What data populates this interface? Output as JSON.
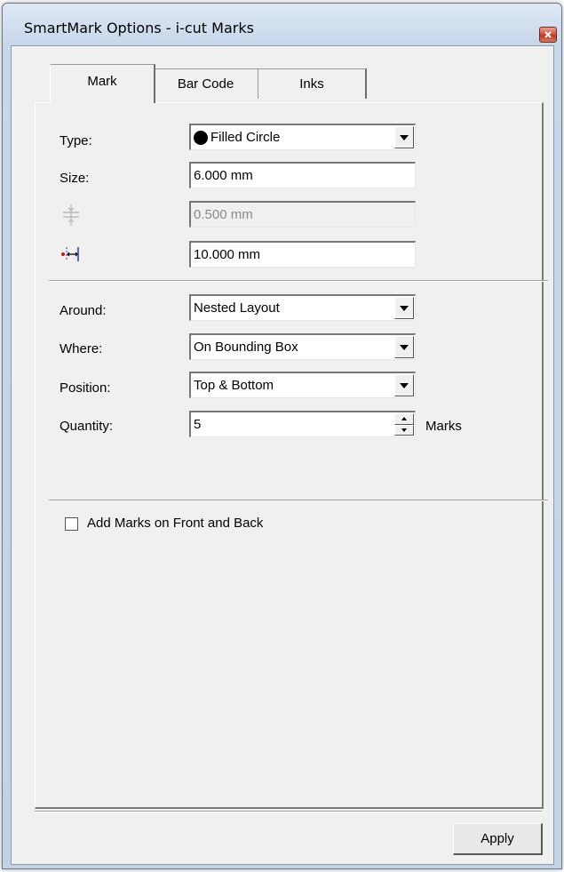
{
  "window": {
    "title": "SmartMark Options - i-cut Marks",
    "close_icon": "close-icon"
  },
  "tabs": [
    {
      "label": "Mark",
      "active": true
    },
    {
      "label": "Bar Code",
      "active": false
    },
    {
      "label": "Inks",
      "active": false
    }
  ],
  "mark": {
    "type": {
      "label": "Type:",
      "value": "Filled Circle",
      "icon": "filled-circle-icon"
    },
    "size": {
      "label": "Size:",
      "value": "6.000 mm"
    },
    "offset": {
      "icon": "crosshair-offset-icon",
      "value": "0.500 mm",
      "disabled": true
    },
    "distance": {
      "icon": "horizontal-distance-icon",
      "value": "10.000 mm"
    },
    "around": {
      "label": "Around:",
      "value": "Nested Layout"
    },
    "where": {
      "label": "Where:",
      "value": "On Bounding Box"
    },
    "position": {
      "label": "Position:",
      "value": "Top & Bottom"
    },
    "quantity": {
      "label": "Quantity:",
      "value": "5",
      "unit": "Marks"
    },
    "front_back": {
      "label": "Add Marks on Front and Back",
      "checked": false
    }
  },
  "footer": {
    "apply_label": "Apply"
  }
}
